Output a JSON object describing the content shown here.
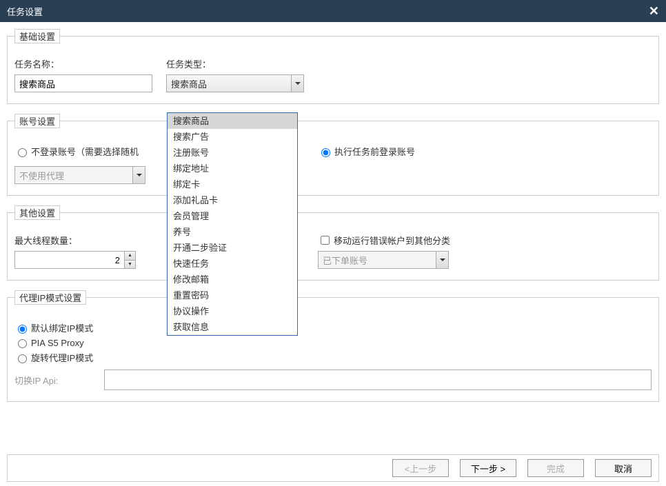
{
  "dialog": {
    "title": "任务设置"
  },
  "basic": {
    "legend": "基础设置",
    "taskNameLabel": "任务名称：",
    "taskNameValue": "搜索商品",
    "taskTypeLabel": "任务类型：",
    "taskTypeValue": "搜索商品",
    "taskTypeOptions": [
      "搜索商品",
      "搜索广告",
      "注册账号",
      "绑定地址",
      "绑定卡",
      "添加礼品卡",
      "会员管理",
      "养号",
      "开通二步验证",
      "快速任务",
      "修改邮箱",
      "重置密码",
      "协议操作",
      "获取信息"
    ]
  },
  "account": {
    "legend": "账号设置",
    "opt1": "不登录账号（需要选择随机",
    "opt2": "执行任务前登录账号",
    "proxyValue": "不使用代理"
  },
  "other": {
    "legend": "其他设置",
    "maxThreadsLabel": "最大线程数量：",
    "maxThreadsValue": "2",
    "moveErrorAccount": "移动运行错误帐户到其他分类",
    "orderedAccountValue": "已下单账号"
  },
  "proxy": {
    "legend": "代理IP模式设置",
    "opt1": "默认绑定IP模式",
    "opt2": "PIA S5 Proxy",
    "opt3": "旋转代理IP模式",
    "apiLabel": "切换IP Api:"
  },
  "footer": {
    "prev": "<上一步",
    "next": "下一步 >",
    "finish": "完成",
    "cancel": "取消"
  }
}
